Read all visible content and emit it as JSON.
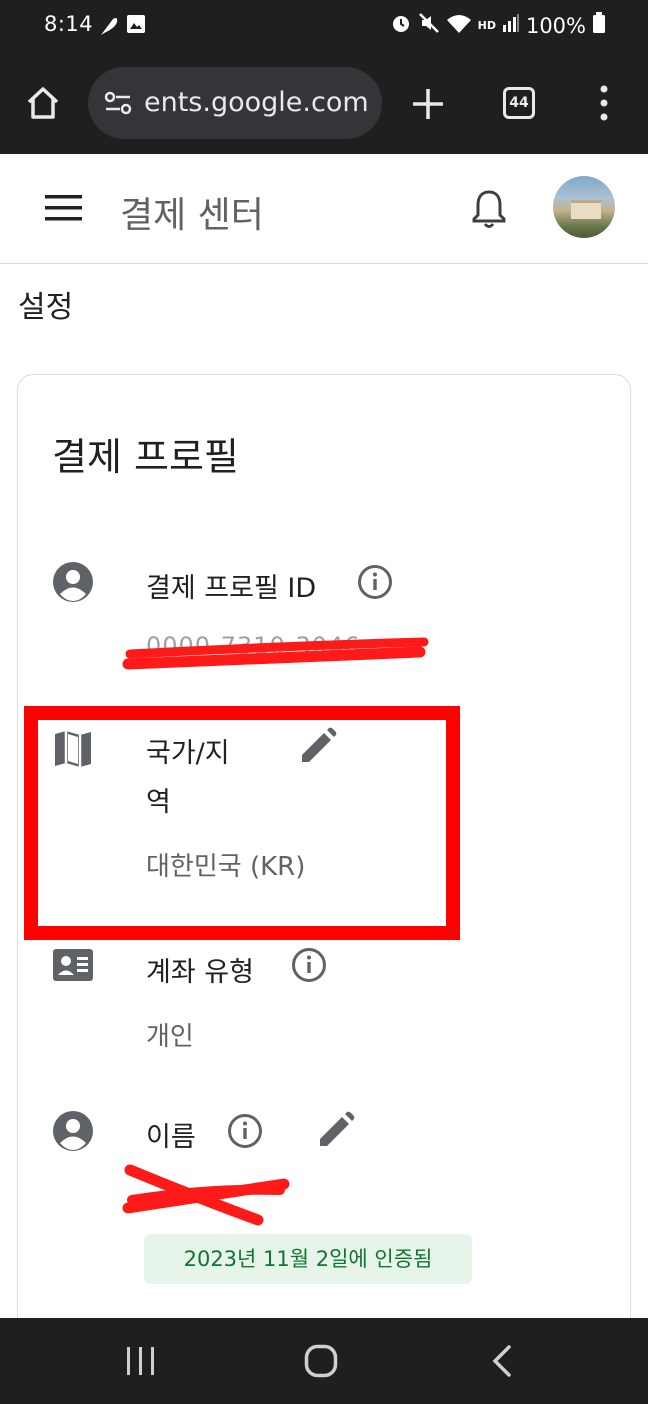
{
  "status_bar": {
    "time": "8:14",
    "battery": "100%",
    "network_badge": "HD",
    "icons": [
      "feather-icon",
      "image-icon",
      "alarm-icon",
      "mute-icon",
      "wifi-icon",
      "signal-icon",
      "battery-icon"
    ]
  },
  "browser": {
    "url": "ents.google.com",
    "tab_count": "44",
    "icons": [
      "home-icon",
      "site-settings-icon",
      "new-tab-icon",
      "tab-switcher-icon",
      "menu-icon"
    ]
  },
  "app_header": {
    "title": "결제 센터",
    "icons": [
      "hamburger-menu-icon",
      "notifications-bell-icon",
      "avatar"
    ]
  },
  "page": {
    "section_title": "설정",
    "card_title": "결제 프로필"
  },
  "profile": {
    "profile_id_label": "결제 프로필 ID",
    "profile_id_value": "0000-7310-3046",
    "country_label_line1": "국가/지",
    "country_label_line2": "역",
    "country_value": "대한민국 (KR)",
    "account_type_label": "계좌 유형",
    "account_type_value": "개인",
    "name_label": "이름",
    "name_value": "",
    "verified_text": "2023년 11월 2일에 인증됨"
  },
  "colors": {
    "annotation_red": "#ff0000",
    "verified_bg": "#e6f4ea",
    "verified_text": "#137333",
    "icon_gray": "#5f6368",
    "system_bar": "#1f1f1f"
  }
}
